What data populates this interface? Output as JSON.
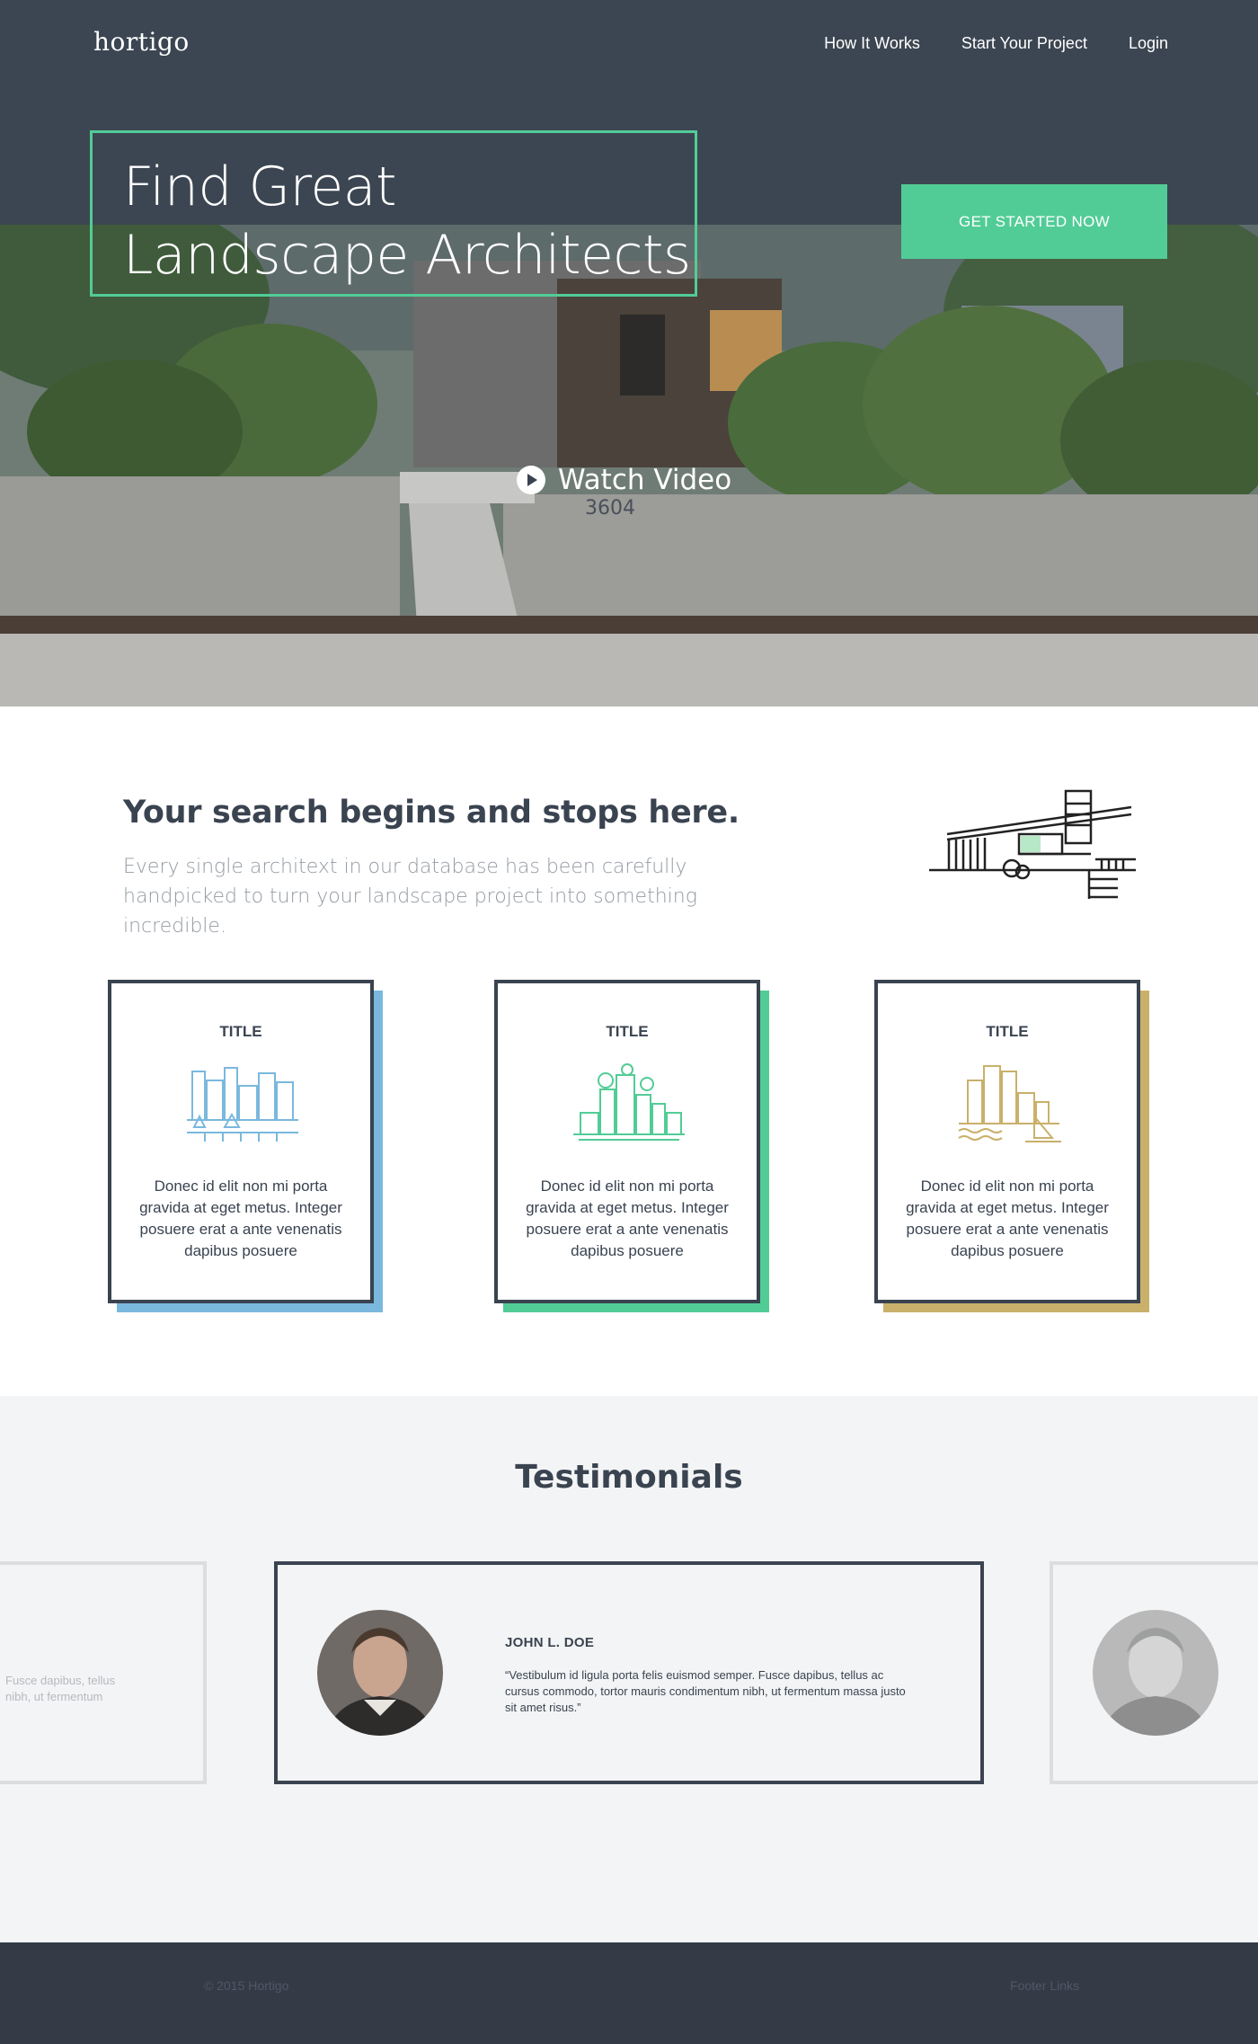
{
  "brand": {
    "logo": "hortigo",
    "accent": "#52cc96",
    "dark": "#3a4350"
  },
  "nav": {
    "items": [
      "How It Works",
      "Start Your Project",
      "Login"
    ]
  },
  "hero": {
    "headline_line1": "Find Great",
    "headline_line2": "Landscape Architects",
    "cta_label": "GET STARTED NOW",
    "watch_label": "Watch Video",
    "watch_count": "3604"
  },
  "search": {
    "title": "Your search begins and stops here.",
    "description": "Every single architext in our database has been carefully handpicked to turn your landscape project into something incredible."
  },
  "cards": [
    {
      "title": "TITLE",
      "text": "Donec id elit non mi porta gravida at eget metus. Inte­ger posuere erat a ante venenatis dapibus posuere",
      "color": "#7ab8de",
      "icon": "city-skyline-icon"
    },
    {
      "title": "TITLE",
      "text": "Donec id elit non mi porta gravida at eget metus. Inte­ger posuere erat a ante venenatis dapibus posuere",
      "color": "#52cc96",
      "icon": "green-city-icon"
    },
    {
      "title": "TITLE",
      "text": "Donec id elit non mi porta gravida at eget metus. Inte­ger posuere erat a ante venenatis dapibus posuere",
      "color": "#c9b06b",
      "icon": "harbor-city-icon"
    }
  ],
  "testimonials": {
    "title": "Testimonials",
    "main": {
      "name": "JOHN L. DOE",
      "quote": "“Vestibulum id ligula porta felis euismod semper. Fusce dapibus, tellus ac cursus commodo, tortor mauris condimentum nibh, ut fermentum massa justo sit amet risus.”"
    },
    "left_partial": "Fusce dapibus, tellus\nnibh, ut fermentum"
  },
  "footer": {
    "copyright": "© 2015 Hortigo",
    "links": "Footer Links"
  }
}
